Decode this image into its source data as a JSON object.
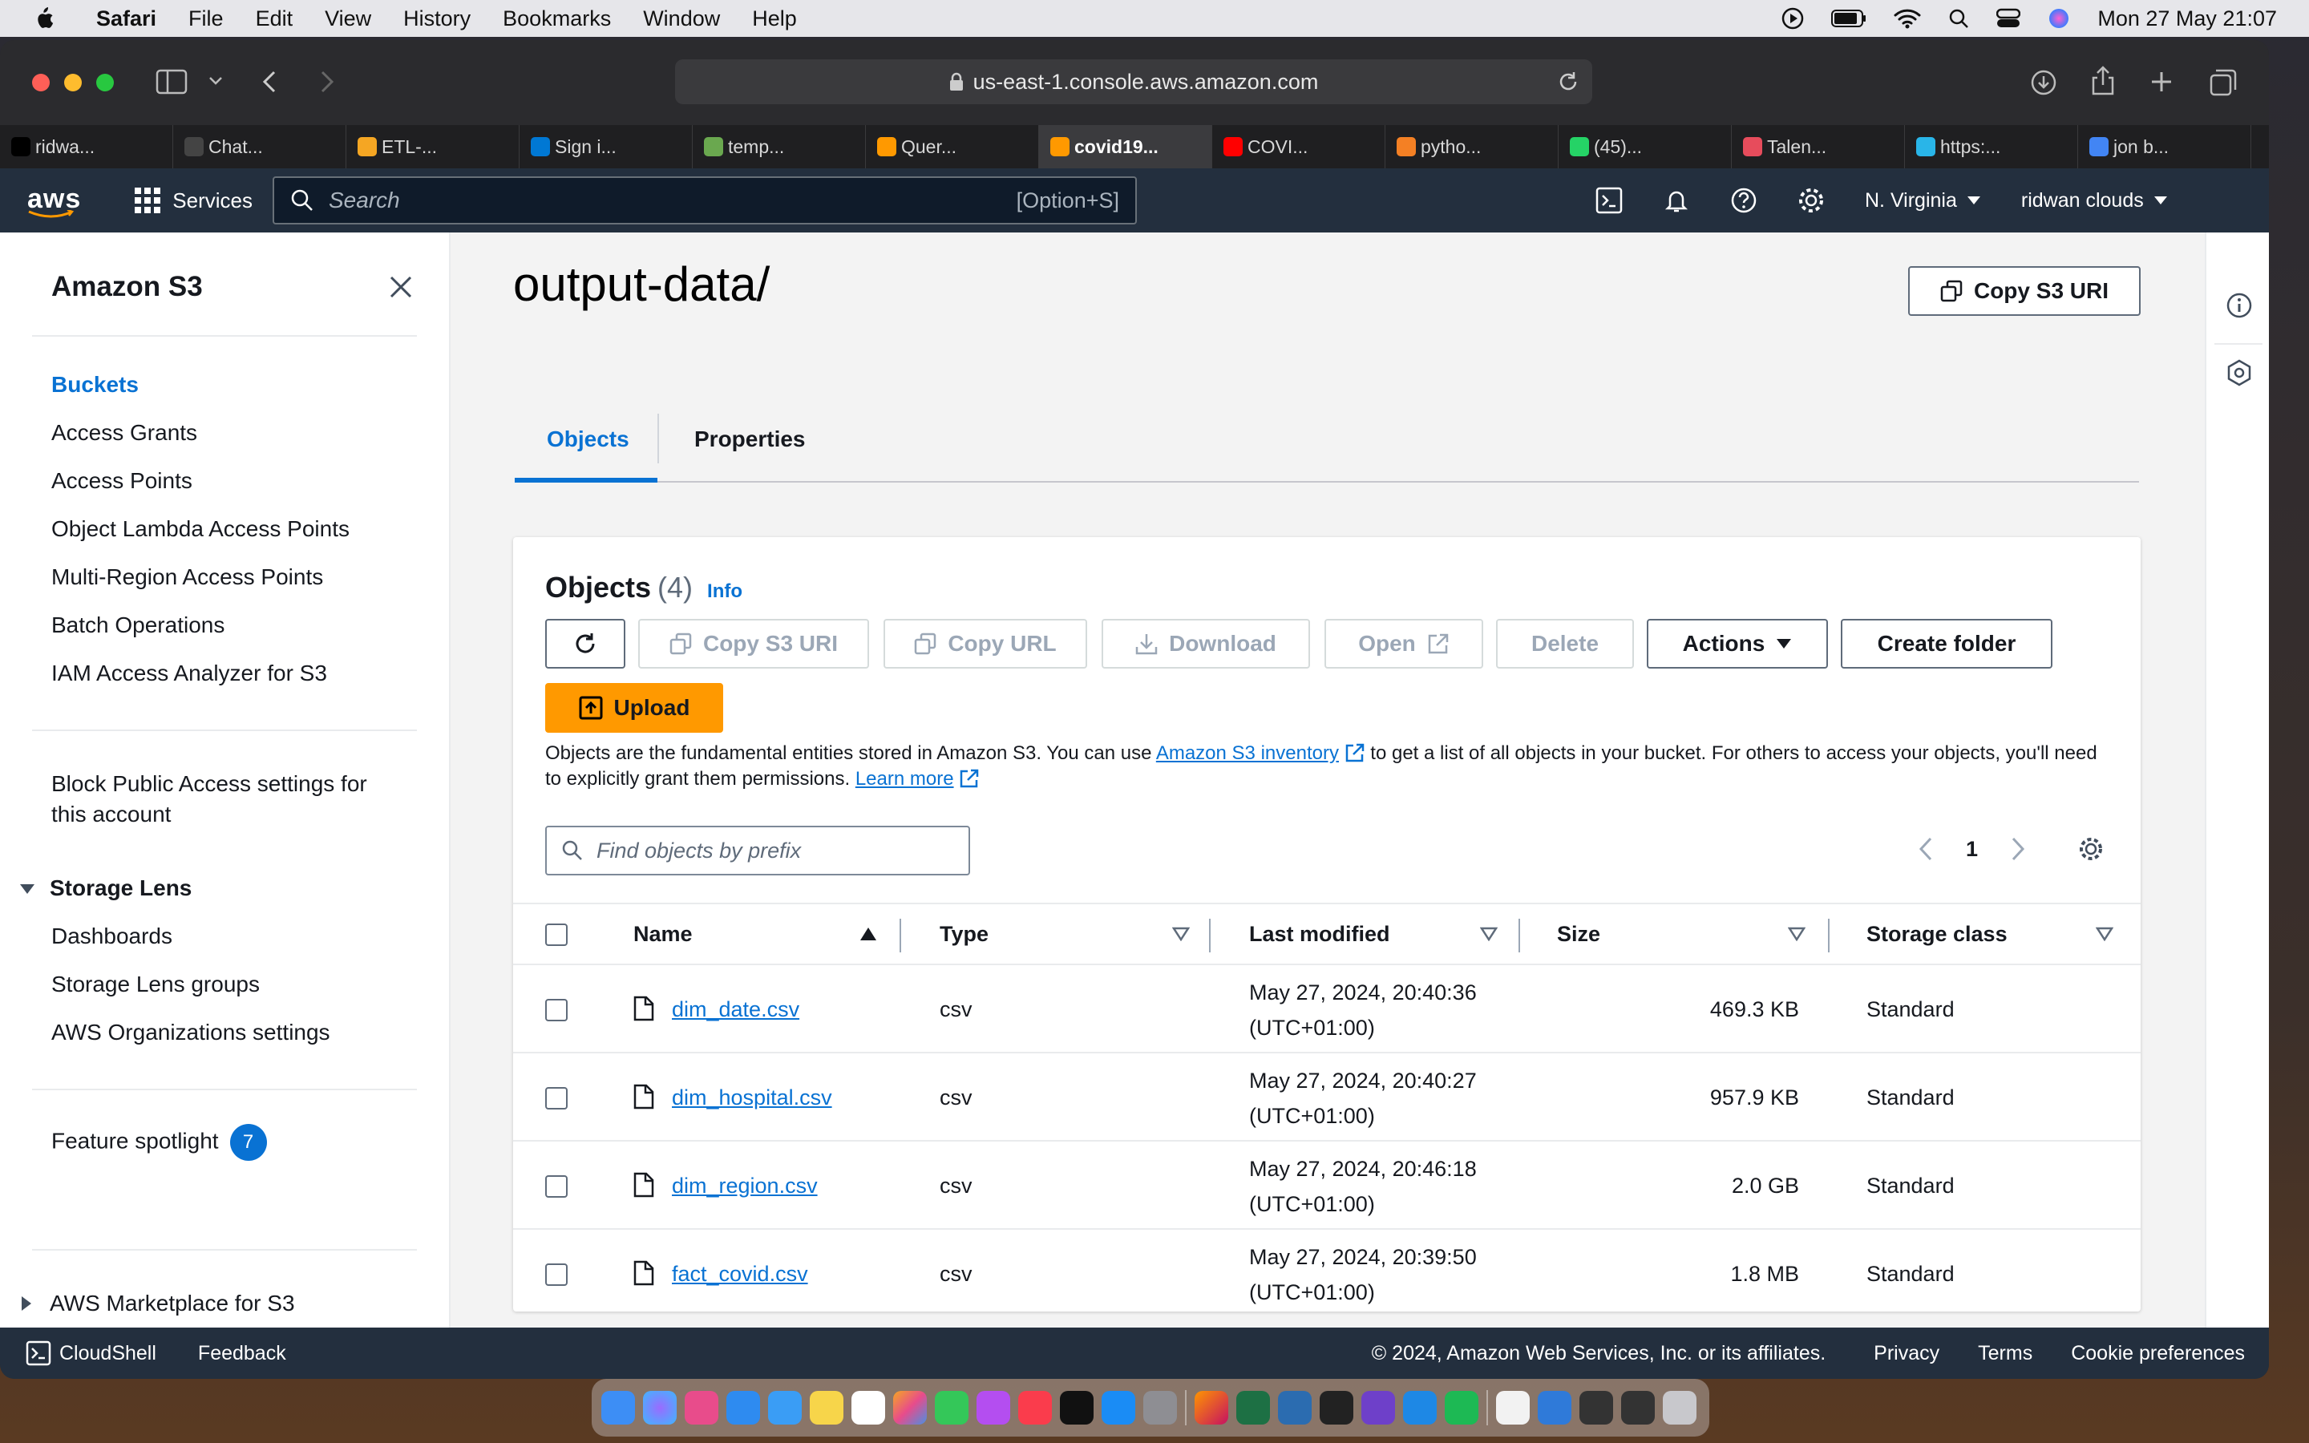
{
  "menubar": {
    "app": "Safari",
    "items": [
      "File",
      "Edit",
      "View",
      "History",
      "Bookmarks",
      "Window",
      "Help"
    ],
    "datetime": "Mon 27 May  21:07"
  },
  "browser": {
    "url": "us-east-1.console.aws.amazon.com",
    "tabs": [
      {
        "label": "ridwa...",
        "color": "#000000"
      },
      {
        "label": "Chat...",
        "color": "#444444"
      },
      {
        "label": "ETL-...",
        "color": "#f5a623"
      },
      {
        "label": "Sign i...",
        "color": "#0078d4"
      },
      {
        "label": "temp...",
        "color": "#6aa84f"
      },
      {
        "label": "Quer...",
        "color": "#ff9900"
      },
      {
        "label": "covid19...",
        "color": "#ff9900"
      },
      {
        "label": "COVI...",
        "color": "#ff0000"
      },
      {
        "label": "pytho...",
        "color": "#f48024"
      },
      {
        "label": "(45)...",
        "color": "#25d366"
      },
      {
        "label": "Talen...",
        "color": "#e74c5c"
      },
      {
        "label": "https:...",
        "color": "#29b5e8"
      },
      {
        "label": "jon b...",
        "color": "#4285f4"
      }
    ],
    "active_tab_index": 6
  },
  "aws_nav": {
    "logo": "aws",
    "services_label": "Services",
    "search_placeholder": "Search",
    "search_shortcut": "[Option+S]",
    "region": "N. Virginia",
    "account": "ridwan clouds"
  },
  "sidebar": {
    "title": "Amazon S3",
    "items": [
      "Buckets",
      "Access Grants",
      "Access Points",
      "Object Lambda Access Points",
      "Multi-Region Access Points",
      "Batch Operations",
      "IAM Access Analyzer for S3"
    ],
    "block_public": [
      "Block Public Access settings for",
      "this account"
    ],
    "storage_lens": "Storage Lens",
    "storage_lens_items": [
      "Dashboards",
      "Storage Lens groups",
      "AWS Organizations settings"
    ],
    "feature_spotlight": "Feature spotlight",
    "feature_count": "7",
    "marketplace": "AWS Marketplace for S3"
  },
  "main": {
    "title": "output-data/",
    "copy_uri_btn": "Copy S3 URI",
    "tabs": [
      "Objects",
      "Properties"
    ],
    "panel": {
      "heading": "Objects",
      "count": "(4)",
      "info": "Info",
      "buttons": {
        "copy_uri": "Copy S3 URI",
        "copy_url": "Copy URL",
        "download": "Download",
        "open": "Open",
        "delete": "Delete",
        "actions": "Actions",
        "create_folder": "Create folder",
        "upload": "Upload"
      },
      "desc_1": "Objects are the fundamental entities stored in Amazon S3. You can use ",
      "desc_link": "Amazon S3 inventory",
      "desc_2": " to get a list of all objects in your bucket. For others to access your objects, you'll need to explicitly grant them permissions. ",
      "learn_more": "Learn more",
      "find_placeholder": "Find objects by prefix",
      "page": "1",
      "columns": [
        "Name",
        "Type",
        "Last modified",
        "Size",
        "Storage class"
      ],
      "rows": [
        {
          "name": "dim_date.csv",
          "type": "csv",
          "mod1": "May 27, 2024, 20:40:36",
          "mod2": "(UTC+01:00)",
          "size": "469.3 KB",
          "class": "Standard"
        },
        {
          "name": "dim_hospital.csv",
          "type": "csv",
          "mod1": "May 27, 2024, 20:40:27",
          "mod2": "(UTC+01:00)",
          "size": "957.9 KB",
          "class": "Standard"
        },
        {
          "name": "dim_region.csv",
          "type": "csv",
          "mod1": "May 27, 2024, 20:46:18",
          "mod2": "(UTC+01:00)",
          "size": "2.0 GB",
          "class": "Standard"
        },
        {
          "name": "fact_covid.csv",
          "type": "csv",
          "mod1": "May 27, 2024, 20:39:50",
          "mod2": "(UTC+01:00)",
          "size": "1.8 MB",
          "class": "Standard"
        }
      ]
    }
  },
  "footer": {
    "cloudshell": "CloudShell",
    "feedback": "Feedback",
    "copyright": "© 2024, Amazon Web Services, Inc. or its affiliates.",
    "privacy": "Privacy",
    "terms": "Terms",
    "cookies": "Cookie preferences"
  },
  "colors": {
    "aws_nav": "#232f3e",
    "link": "#0972d3",
    "upload": "#ff9900"
  }
}
